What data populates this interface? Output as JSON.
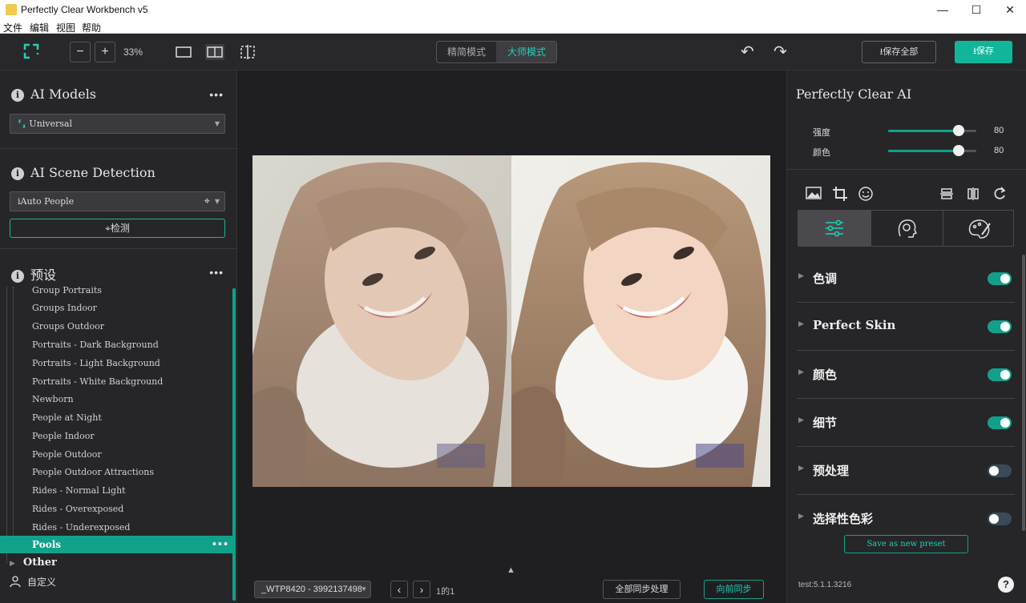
{
  "window": {
    "title": "Perfectly Clear Workbench v5",
    "minimize": "—",
    "maximize": "☐",
    "close": "✕"
  },
  "menu": [
    "文件",
    "编辑",
    "视图",
    "帮助"
  ],
  "toolbar": {
    "zoom_out": "−",
    "zoom_in": "+",
    "zoom_level": "33%",
    "mode_simple": "精简模式",
    "mode_master": "大师模式",
    "active_mode": "大师模式",
    "undo_icon": "↶",
    "redo_icon": "↷",
    "save_all": "保存全部",
    "save": "保存",
    "accent": "#11a18a"
  },
  "left": {
    "ai_models": {
      "title": "AI Models",
      "dots": "•••",
      "selected": "Universal"
    },
    "scene": {
      "title": "AI Scene Detection",
      "selected": "iAuto People",
      "detect": "检测"
    },
    "presets": {
      "title": "预设",
      "dots": "•••",
      "items": [
        "Group Portraits",
        "Groups Indoor",
        "Groups Outdoor",
        "Portraits - Dark Background",
        "Portraits - Light Background",
        "Portraits - White Background",
        "Newborn",
        "People at Night",
        "People Indoor",
        "People Outdoor",
        "People Outdoor Attractions",
        "Rides - Normal Light",
        "Rides - Overexposed",
        "Rides - Underexposed"
      ],
      "selected": "Pools",
      "group_other": "Other",
      "custom": "自定义"
    }
  },
  "center": {
    "file_select": "_WTP8420 - 3992137498",
    "prev_icon": "‹",
    "next_icon": "›",
    "page": "1的1",
    "sync_all": "全部同步处理",
    "sync_forward": "向前同步"
  },
  "right": {
    "title": "Perfectly Clear AI",
    "sliders": [
      {
        "label": "强度",
        "value": 80
      },
      {
        "label": "颜色",
        "value": 80
      }
    ],
    "sections": [
      {
        "label": "色调",
        "on": true
      },
      {
        "label": "Perfect Skin",
        "on": true
      },
      {
        "label": "颜色",
        "on": true
      },
      {
        "label": "细节",
        "on": true
      },
      {
        "label": "预处理",
        "on": false
      },
      {
        "label": "选择性色彩",
        "on": false
      }
    ],
    "save_preset": "Save as new preset",
    "version": "test:5.1.1.3216",
    "help": "?"
  }
}
